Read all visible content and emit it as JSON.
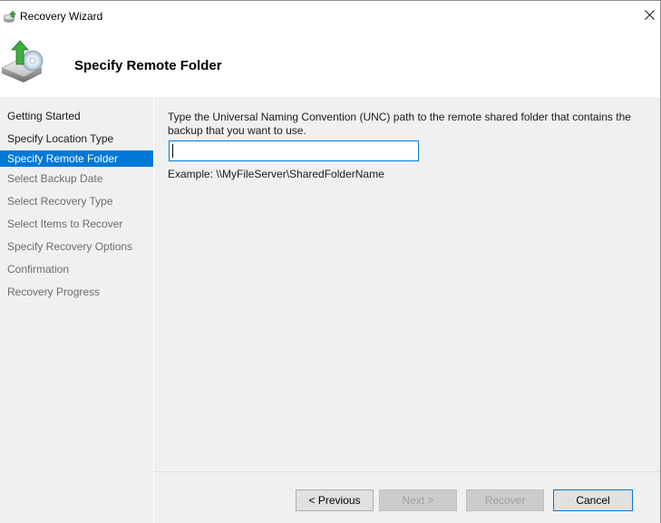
{
  "window": {
    "title": "Recovery Wizard",
    "close_glyph": "✕"
  },
  "header": {
    "title": "Specify Remote Folder",
    "icon": "backup-drive-icon"
  },
  "nav": {
    "items": [
      {
        "label": "Getting Started",
        "state": "done"
      },
      {
        "label": "Specify Location Type",
        "state": "done"
      },
      {
        "label": "Specify Remote Folder",
        "state": "active"
      },
      {
        "label": "Select Backup Date",
        "state": "pending"
      },
      {
        "label": "Select Recovery Type",
        "state": "pending"
      },
      {
        "label": "Select Items to Recover",
        "state": "pending"
      },
      {
        "label": "Specify Recovery Options",
        "state": "pending"
      },
      {
        "label": "Confirmation",
        "state": "pending"
      },
      {
        "label": "Recovery Progress",
        "state": "pending"
      }
    ]
  },
  "content": {
    "instructions": "Type the Universal Naming Convention (UNC) path to the remote shared folder that contains the backup that you want to use.",
    "path_value": "",
    "example": "Example: \\\\MyFileServer\\SharedFolderName"
  },
  "buttons": {
    "previous": "< Previous",
    "next": "Next >",
    "recover": "Recover",
    "cancel": "Cancel"
  },
  "colors": {
    "accent": "#0078d7",
    "panel": "#f0f0f0"
  }
}
